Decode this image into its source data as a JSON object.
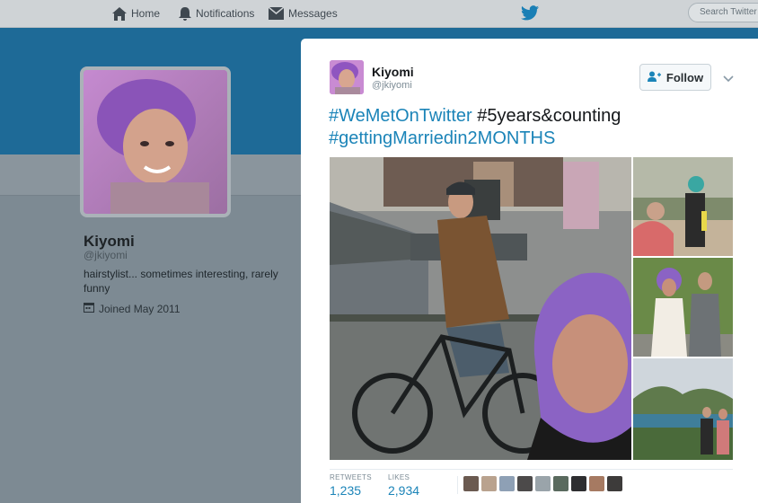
{
  "nav": {
    "home_label": "Home",
    "notifications_label": "Notifications",
    "messages_label": "Messages",
    "search_placeholder": "Search Twitter"
  },
  "profile": {
    "name": "Kiyomi",
    "handle": "@jkiyomi",
    "bio": "hairstylist... sometimes interesting, rarely funny",
    "joined": "Joined May 2011"
  },
  "tweet": {
    "author_name": "Kiyomi",
    "author_handle": "@jkiyomi",
    "follow_label": "Follow",
    "hashtag_1": "#WeMetOnTwitter",
    "text_plain": "#5years&counting",
    "hashtag_2": "#gettingMarriedin2MONTHS",
    "retweets_label": "RETWEETS",
    "retweets_count": "1,235",
    "likes_label": "LIKES",
    "likes_count": "2,934"
  },
  "colors": {
    "twitter_blue": "#1da1f2",
    "link_blue": "#1b84b8",
    "banner": "#1e6a97"
  },
  "icons": [
    "home-icon",
    "notifications-icon",
    "messages-icon",
    "twitter-bird-icon",
    "calendar-icon",
    "follow-person-icon",
    "chevron-down-icon"
  ]
}
